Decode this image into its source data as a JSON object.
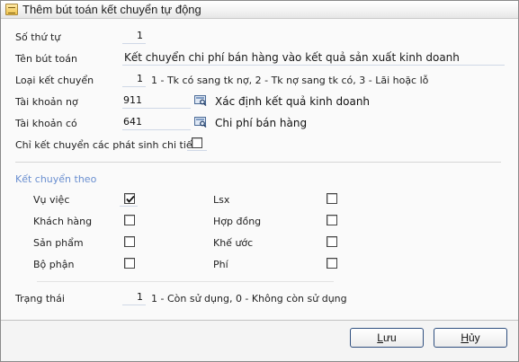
{
  "window": {
    "title": "Thêm bút toán kết chuyển tự động"
  },
  "form": {
    "so_thu_tu": {
      "label": "Số thứ tự",
      "value": "1"
    },
    "ten_but_toan": {
      "label": "Tên bút toán",
      "value": "Kết chuyển chi phí bán hàng vào kết quả sản xuất kinh doanh"
    },
    "loai_ket_chuyen": {
      "label": "Loại kết chuyển",
      "value": "1",
      "hint": "1 - Tk có sang tk nợ, 2 - Tk nợ sang tk có, 3 - Lãi hoặc lỗ"
    },
    "tai_khoan_no": {
      "label": "Tài khoản nợ",
      "value": "911",
      "description": "Xác định kết quả kinh doanh",
      "lookup_icon": "lookup-icon"
    },
    "tai_khoan_co": {
      "label": "Tài khoản có",
      "value": "641",
      "description": "Chi phí bán hàng",
      "lookup_icon": "lookup-icon"
    },
    "chi_tiet": {
      "label": "Chỉ kết chuyển các phát sinh chi tiết",
      "checked": false
    }
  },
  "ket_chuyen_theo": {
    "title": "Kết chuyển theo",
    "left": [
      {
        "label": "Vụ việc",
        "checked": true
      },
      {
        "label": "Khách hàng",
        "checked": false
      },
      {
        "label": "Sản phẩm",
        "checked": false
      },
      {
        "label": "Bộ phận",
        "checked": false
      }
    ],
    "right": [
      {
        "label": "Lsx",
        "checked": false
      },
      {
        "label": "Hợp đồng",
        "checked": false
      },
      {
        "label": "Khế ước",
        "checked": false
      },
      {
        "label": "Phí",
        "checked": false
      }
    ]
  },
  "trang_thai": {
    "label": "Trạng thái",
    "value": "1",
    "hint": "1 - Còn sử dụng, 0 - Không còn sử dụng"
  },
  "buttons": {
    "save": "Lưu",
    "save_mnemonic": "L",
    "cancel": "Hủy",
    "cancel_mnemonic": "H"
  },
  "colors": {
    "accent": "#6a8fd0",
    "field_underline": "#cfd8e6",
    "button_border": "#2f4f7f"
  }
}
